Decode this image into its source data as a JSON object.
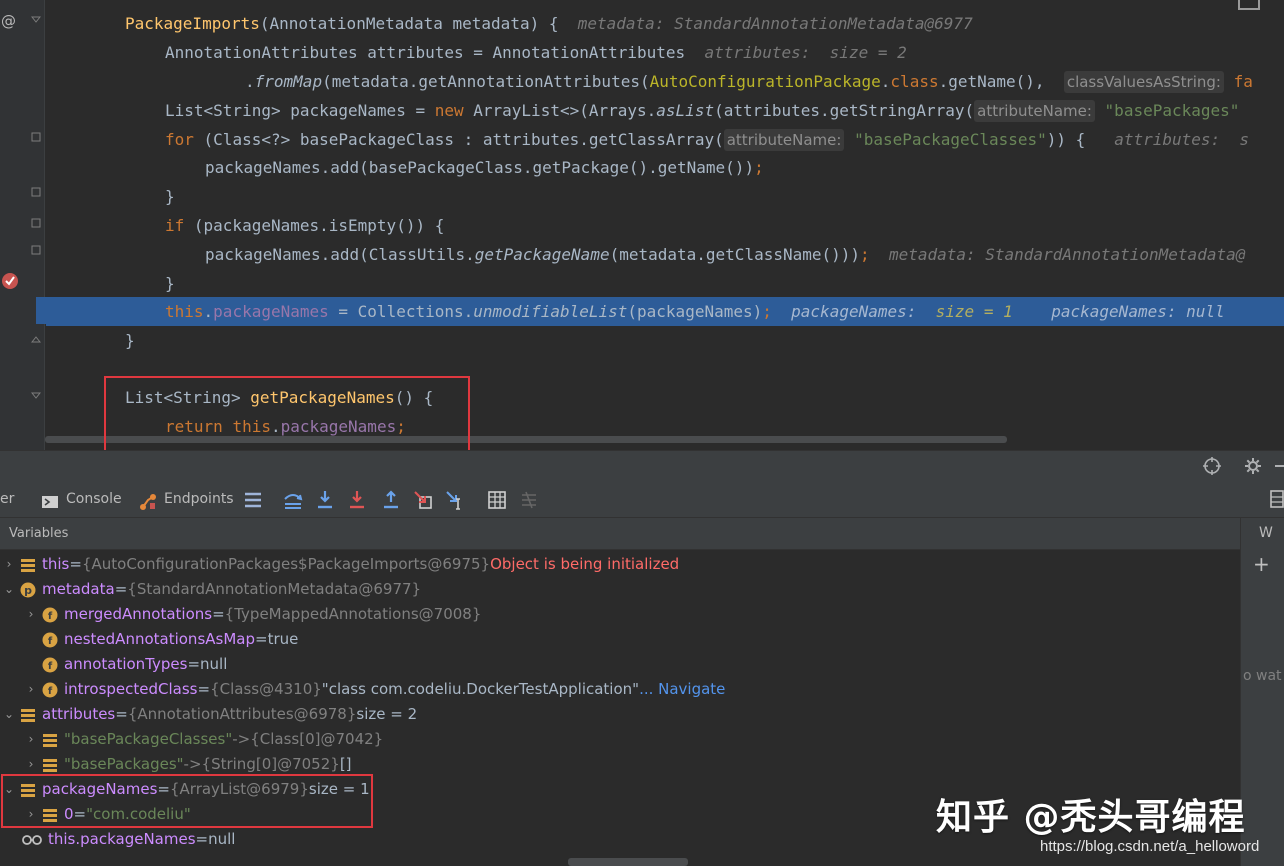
{
  "editor": {
    "lines": {
      "l1": {
        "a": "PackageImports",
        "b": "(AnnotationMetadata metadata) {",
        "hint": "metadata: StandardAnnotationMetadata@6977"
      },
      "l2": {
        "a": "AnnotationAttributes attributes = AnnotationAttributes",
        "hint_name": "attributes:",
        "hint_val": "size = 2"
      },
      "l3": {
        "a": ".",
        "fn": "fromMap",
        "b": "(metadata.getAnnotationAttributes(",
        "cls": "AutoConfigurationPackage",
        "c": ".",
        "kw": "class",
        "d": ".getName(),",
        "param": "classValuesAsString:",
        "tail": "fa"
      },
      "l4": {
        "a": "List<String> packageNames = ",
        "kw": "new",
        "b": " ArrayList<>(Arrays.",
        "fn": "asList",
        "c": "(attributes.getStringArray(",
        "param": "attributeName:",
        "str": "\"basePackages\""
      },
      "l5": {
        "kw": "for",
        "a": " (Class<?> basePackageClass : attributes.getClassArray(",
        "param": "attributeName:",
        "str": "\"basePackageClasses\"",
        "b": ")) {",
        "hint": "attributes:  s"
      },
      "l6": {
        "a": "packageNames.add(basePackageClass.getPackage().getName())",
        "semi": ";"
      },
      "l7": {
        "a": "}"
      },
      "l8": {
        "kw": "if",
        "a": " (packageNames.isEmpty()) {"
      },
      "l9": {
        "a": "packageNames.add(ClassUtils.",
        "fn": "getPackageName",
        "b": "(metadata.getClassName()))",
        "semi": ";",
        "hint": "metadata: StandardAnnotationMetadata@"
      },
      "l10": {
        "a": "}"
      },
      "l11": {
        "kw": "this",
        "dot": ".",
        "field": "packageNames",
        "a": " = Collections.",
        "fn": "unmodifiableList",
        "b": "(packageNames)",
        "semi": ";",
        "hint1": "packageNames:",
        "hint1_val": "size = 1",
        "hint2": "packageNames: null"
      },
      "l12": {
        "a": "}"
      },
      "l13": {
        "a": "List<String> ",
        "fn": "getPackageNames",
        "b": "() {"
      },
      "l14": {
        "kw": "return",
        "sp": " ",
        "kw2": "this",
        "dot": ".",
        "field": "packageNames",
        "semi": ";"
      }
    }
  },
  "toolbar": {
    "partial_tab": "er",
    "console_label": "Console",
    "endpoints_label": "Endpoints"
  },
  "variables": {
    "title": "Variables",
    "rows": [
      {
        "name": "this",
        "eq": " = ",
        "ref": "{AutoConfigurationPackages$PackageImports@6975}",
        "extra": " Object is being initialized"
      },
      {
        "name": "metadata",
        "eq": " = ",
        "ref": "{StandardAnnotationMetadata@6977}"
      },
      {
        "name": "mergedAnnotations",
        "eq": " = ",
        "ref": "{TypeMappedAnnotations@7008}"
      },
      {
        "name": "nestedAnnotationsAsMap",
        "eq": " = ",
        "val": "true"
      },
      {
        "name": "annotationTypes",
        "eq": " = ",
        "val": "null"
      },
      {
        "name": "introspectedClass",
        "eq": " = ",
        "ref": "{Class@4310}",
        "val": " \"class com.codeliu.DockerTestApplication\"",
        "link": " ... Navigate"
      },
      {
        "name": "attributes",
        "eq": " = ",
        "ref": "{AnnotationAttributes@6978}",
        "val": "  size = 2"
      },
      {
        "name": "\"basePackageClasses\"",
        "eq": " -> ",
        "ref": "{Class[0]@7042}"
      },
      {
        "name": "\"basePackages\"",
        "eq": " -> ",
        "ref": "{String[0]@7052}",
        "val": " []"
      },
      {
        "name": "packageNames",
        "eq": " = ",
        "ref": "{ArrayList@6979}",
        "val": "  size = 1"
      },
      {
        "name": "0",
        "eq": " = ",
        "str": "\"com.codeliu\""
      },
      {
        "name": "this.packageNames",
        "eq": " = ",
        "val": "null"
      }
    ]
  },
  "right_panel": {
    "w_label": "W",
    "plus": "+",
    "watches_text": "o wat"
  },
  "watermark": {
    "zhihu": "知乎 @秃头哥编程",
    "url": "https://blog.csdn.net/a_helloword"
  },
  "colors": {
    "selection": "#2d5c98",
    "annotation_box": "#e0383f",
    "editor_bg": "#2b2b2b",
    "panel_bg": "#3c3f41"
  }
}
